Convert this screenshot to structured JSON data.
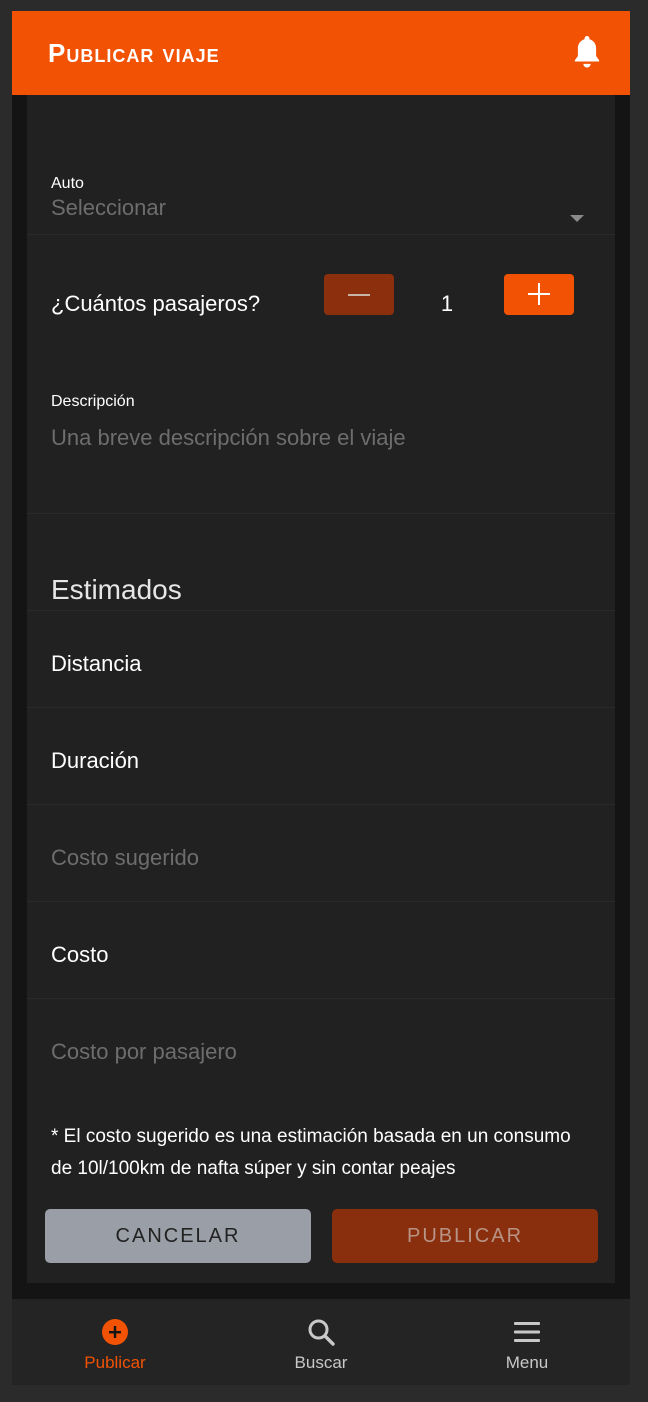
{
  "header": {
    "title": "Publicar viaje",
    "notifications_icon": "bell-icon"
  },
  "form": {
    "auto": {
      "label": "Auto",
      "placeholder": "Seleccionar",
      "dropdown_icon": "caret-down-icon"
    },
    "passengers": {
      "label": "¿Cuántos pasajeros?",
      "count": "1",
      "decrement_icon": "minus-icon",
      "increment_icon": "plus-icon"
    },
    "description": {
      "label": "Descripción",
      "placeholder": "Una breve descripción sobre el viaje"
    }
  },
  "estimates": {
    "title": "Estimados",
    "distance_label": "Distancia",
    "duration_label": "Duración",
    "suggested_cost_placeholder": "Costo sugerido",
    "cost_label": "Costo",
    "cost_per_passenger_placeholder": "Costo por pasajero",
    "note": "* El costo sugerido es una estimación basada en un consumo de 10l/100km de nafta súper y sin contar peajes"
  },
  "actions": {
    "cancel_label": "CANCELAR",
    "publish_label": "PUBLICAR"
  },
  "bottom_nav": {
    "items": [
      {
        "label": "Publicar",
        "icon": "add-circle-icon",
        "active": true
      },
      {
        "label": "Buscar",
        "icon": "search-icon",
        "active": false
      },
      {
        "label": "Menu",
        "icon": "menu-icon",
        "active": false
      }
    ]
  },
  "colors": {
    "accent": "#f25204",
    "accent_disabled": "#8a2f0e",
    "background": "#141414",
    "card": "#212121",
    "cancel_button": "#9a9ea6"
  }
}
